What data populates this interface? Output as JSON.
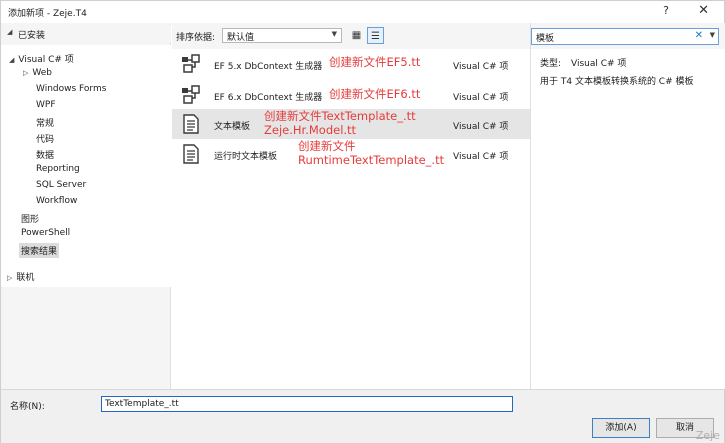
{
  "window": {
    "title": "添加新项 - Zeje.T4",
    "help": "?",
    "close": "✕"
  },
  "left": {
    "installed": "已安装",
    "tree": [
      {
        "label": "Visual C# 项",
        "caret": "◢"
      },
      {
        "label": "Web",
        "caret": "▷"
      },
      {
        "label": "Windows Forms"
      },
      {
        "label": "WPF"
      },
      {
        "label": "常规"
      },
      {
        "label": "代码"
      },
      {
        "label": "数据"
      },
      {
        "label": "Reporting"
      },
      {
        "label": "SQL Server"
      },
      {
        "label": "Workflow"
      },
      {
        "label": "图形"
      },
      {
        "label": "PowerShell"
      },
      {
        "label": "搜索结果"
      }
    ],
    "online": "联机"
  },
  "toolbar": {
    "sort_label": "排序依据:",
    "sort_value": "默认值"
  },
  "templates": [
    {
      "name": "EF 5.x DbContext 生成器",
      "lang": "Visual C# 项",
      "icon": "ef-generator-icon"
    },
    {
      "name": "EF 6.x DbContext 生成器",
      "lang": "Visual C# 项",
      "icon": "ef-generator-icon"
    },
    {
      "name": "文本模板",
      "lang": "Visual C# 项",
      "icon": "document-icon"
    },
    {
      "name": "运行时文本模板",
      "lang": "Visual C# 项",
      "icon": "document-icon"
    }
  ],
  "annotations": {
    "a1": "创建新文件EF5.tt",
    "a2": "创建新文件EF6.tt",
    "a3_line1": "创建新文件TextTemplate_.tt",
    "a3_line2": "Zeje.Hr.Model.tt",
    "a4_line1": "创建新文件",
    "a4_line2": "RumtimeTextTemplate_.tt",
    "color": "#e63b3b"
  },
  "search": {
    "value": "模板"
  },
  "details": {
    "type_label": "类型:",
    "type_value": "Visual C# 项",
    "description": "用于 T4 文本模板转换系统的 C# 模板"
  },
  "bottom": {
    "name_label": "名称(N):",
    "name_value": "TextTemplate_.tt",
    "add": "添加(A)",
    "cancel": "取消"
  },
  "watermark": "Zeje"
}
